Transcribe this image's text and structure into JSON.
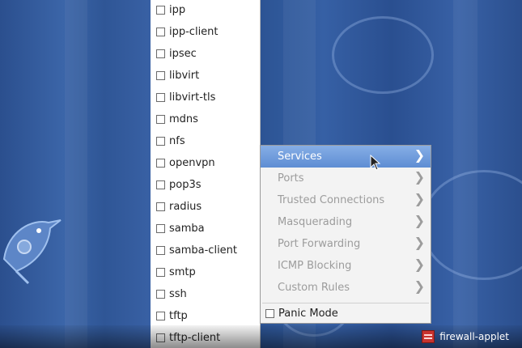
{
  "services": [
    {
      "label": "ipp",
      "checked": false
    },
    {
      "label": "ipp-client",
      "checked": false
    },
    {
      "label": "ipsec",
      "checked": false
    },
    {
      "label": "libvirt",
      "checked": false
    },
    {
      "label": "libvirt-tls",
      "checked": false
    },
    {
      "label": "mdns",
      "checked": false
    },
    {
      "label": "nfs",
      "checked": false
    },
    {
      "label": "openvpn",
      "checked": false
    },
    {
      "label": "pop3s",
      "checked": false
    },
    {
      "label": "radius",
      "checked": false
    },
    {
      "label": "samba",
      "checked": false
    },
    {
      "label": "samba-client",
      "checked": false
    },
    {
      "label": "smtp",
      "checked": false
    },
    {
      "label": "ssh",
      "checked": false
    },
    {
      "label": "tftp",
      "checked": false
    },
    {
      "label": "tftp-client",
      "checked": false
    }
  ],
  "menu": {
    "items": [
      {
        "label": "Services",
        "active": true,
        "enabled": true
      },
      {
        "label": "Ports",
        "active": false,
        "enabled": false
      },
      {
        "label": "Trusted Connections",
        "active": false,
        "enabled": false
      },
      {
        "label": "Masquerading",
        "active": false,
        "enabled": false
      },
      {
        "label": "Port Forwarding",
        "active": false,
        "enabled": false
      },
      {
        "label": "ICMP Blocking",
        "active": false,
        "enabled": false
      },
      {
        "label": "Custom Rules",
        "active": false,
        "enabled": false
      }
    ],
    "panic_mode": {
      "label": "Panic Mode",
      "checked": false
    }
  },
  "tray": {
    "app_label": "firewall-applet",
    "icon": "firewall-icon"
  },
  "colors": {
    "desktop": "#2c5494",
    "menu_highlight": "#6f9bdc"
  }
}
